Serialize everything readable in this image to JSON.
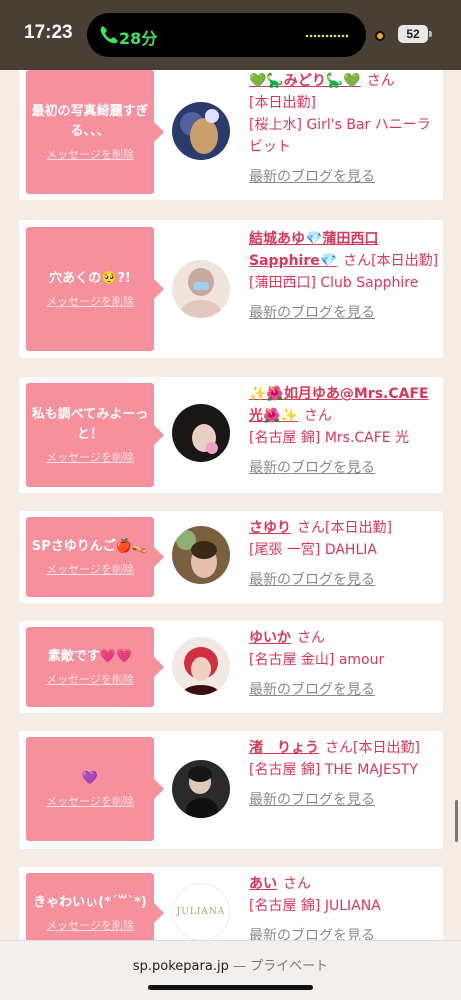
{
  "status": {
    "time": "17:23",
    "call_duration": "28分",
    "battery": "52"
  },
  "cards": [
    {
      "message": "最初の写真綺麗すぎる、、、",
      "delete_label": "メッセージを削除",
      "name": "💚🦕みどり🦕💚",
      "san": "さん",
      "badge": "",
      "shop_lines": [
        "[本日出勤]",
        "[桜上水] Girl's Bar ハニーラビット"
      ],
      "blog": "最新のブログを見る",
      "avatar_colors": [
        "#2a3a6a",
        "#c9a06a"
      ]
    },
    {
      "message": "穴あくの🥺?!",
      "delete_label": "メッセージを削除",
      "name": "結城あゆ💎蒲田西口Sapphire💎",
      "san": "さん",
      "badge": "[本日出勤]",
      "shop_lines": [
        "[蒲田西口] Club Sapphire"
      ],
      "blog": "最新のブログを見る",
      "avatar_colors": [
        "#e8d8d0",
        "#c7a9a0"
      ]
    },
    {
      "message": "私も調べてみよーっと！",
      "delete_label": "メッセージを削除",
      "name": "✨🌺如月ゆあ@Mrs.CAFE光🌺✨",
      "san": "さん",
      "badge": "",
      "shop_lines": [
        "[名古屋 錦] Mrs.CAFE 光"
      ],
      "blog": "最新のブログを見る",
      "avatar_colors": [
        "#1a1616",
        "#f0c0d0"
      ]
    },
    {
      "message": "SPさゆりんご🍎👡",
      "delete_label": "メッセージを削除",
      "name": "さゆり",
      "san": "さん",
      "badge": "[本日出勤]",
      "shop_lines": [
        "[尾張 一宮] DAHLIA"
      ],
      "blog": "最新のブログを見る",
      "avatar_colors": [
        "#6a4a30",
        "#e8c0b0"
      ]
    },
    {
      "message": "素敵です💗💗",
      "delete_label": "メッセージを削除",
      "name": "ゆいか",
      "san": "さん",
      "badge": "",
      "shop_lines": [
        "[名古屋 金山] amour"
      ],
      "blog": "最新のブログを見る",
      "avatar_colors": [
        "#d03040",
        "#f2d0c4"
      ]
    },
    {
      "message": "💜",
      "delete_label": "メッセージを削除",
      "name": "渚　りょう",
      "san": "さん",
      "badge": "[本日出勤]",
      "shop_lines": [
        "[名古屋 錦] THE MAJESTY"
      ],
      "blog": "最新のブログを見る",
      "avatar_colors": [
        "#181818",
        "#e0c8b8"
      ]
    },
    {
      "message": "きゃわいぃ(*´꒳`*)",
      "delete_label": "メッセージを削除",
      "name": "あい",
      "san": "さん",
      "badge": "",
      "shop_lines": [
        "[名古屋 錦] JULIANA"
      ],
      "blog": "最新のブログを見る",
      "avatar_text": "JULIANA",
      "avatar_colors": [
        "#ffffff",
        "#b8a070"
      ]
    }
  ],
  "urlbar": {
    "domain": "sp.pokepara.jp",
    "suffix": "— プライベート"
  }
}
